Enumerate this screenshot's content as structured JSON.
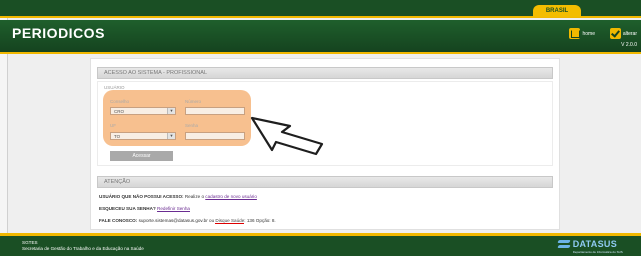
{
  "top": {
    "brasil_label": "BRASIL"
  },
  "header": {
    "title": "PERIODICOS",
    "home_label": "home",
    "logout_label": "alterar",
    "version": "V 2.0.0"
  },
  "login": {
    "section_title": "ACESSO AO SISTEMA - PROFISSIONAL",
    "usuario_label": "USUÁRIO",
    "conselho_label": "Conselho",
    "conselho_value": "CRO",
    "numero_label": "Número",
    "uf_label": "UF",
    "uf_value": "TO",
    "senha_label": "Senha",
    "acessar_label": "Acessar"
  },
  "atencao": {
    "section_title": "ATENÇÃO",
    "line1_bold": "USUÁRIO QUE NÃO POSSUI ACESSO:",
    "line1_text": " Realize o ",
    "line1_link": "cadastro de novo usuário",
    "line2_bold": "ESQUECEU SUA SENHA?",
    "line2_link": "Redefinir Senha",
    "line3_bold": "FALE CONOSCO:",
    "line3_text": " suporte.sistemas@datasus.gov.br ou ",
    "line3_link": "Disque Saúde",
    "line3_suffix": ": 136 Opção: 8."
  },
  "footer": {
    "sgtes": "SGTES",
    "secretaria": "Secretaria de Gestão do Trabalho e da Educação na Saúde",
    "datasus": "DATASUS",
    "datasus_sub": "Departamento de Informática do SUS"
  },
  "colors": {
    "dark_green": "#1a4f24",
    "gold": "#f1b800",
    "highlight_orange": "#f4a864",
    "link_purple": "#6a2c91"
  },
  "icons": [
    "home-icon",
    "check-icon",
    "pointer-cursor-icon",
    "dropdown-arrow-icon",
    "datasus-logo"
  ]
}
